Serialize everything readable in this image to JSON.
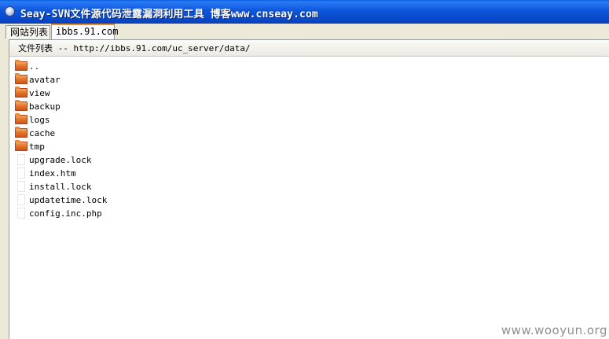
{
  "window": {
    "title": "Seay-SVN文件源代码泄露漏洞利用工具   博客www.cnseay.com",
    "icon": "app-globe-icon"
  },
  "tabs": [
    {
      "label": "网站列表",
      "active": false
    },
    {
      "label": "ibbs.91.com",
      "active": true
    }
  ],
  "list_header": "文件列表 -- http://ibbs.91.com/uc_server/data/",
  "files": [
    {
      "name": "..",
      "type": "folder",
      "icon": "folder-icon"
    },
    {
      "name": "avatar",
      "type": "folder",
      "icon": "folder-icon"
    },
    {
      "name": "view",
      "type": "folder",
      "icon": "folder-icon"
    },
    {
      "name": "backup",
      "type": "folder",
      "icon": "folder-icon"
    },
    {
      "name": "logs",
      "type": "folder",
      "icon": "folder-icon"
    },
    {
      "name": "cache",
      "type": "folder",
      "icon": "folder-icon"
    },
    {
      "name": "tmp",
      "type": "folder",
      "icon": "folder-icon"
    },
    {
      "name": "upgrade.lock",
      "type": "file",
      "icon": "file-icon"
    },
    {
      "name": "index.htm",
      "type": "file",
      "icon": "file-icon"
    },
    {
      "name": "install.lock",
      "type": "file",
      "icon": "file-icon"
    },
    {
      "name": "updatetime.lock",
      "type": "file",
      "icon": "file-icon"
    },
    {
      "name": "config.inc.php",
      "type": "file",
      "icon": "file-icon"
    }
  ],
  "watermark": "www.wooyun.org",
  "colors": {
    "titlebar": "#0a56dc",
    "active_tab_accent": "#e68b2c",
    "folder": "#e5762c"
  }
}
